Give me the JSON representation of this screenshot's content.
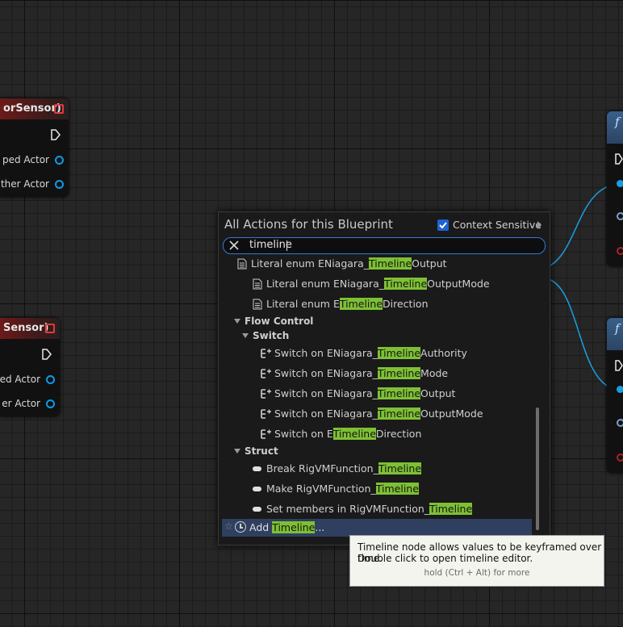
{
  "left_nodes": [
    {
      "title": "orSensor)",
      "pins": [
        "ped Actor",
        "ther Actor"
      ]
    },
    {
      "title": "Sensor)",
      "pins": [
        "ed Actor",
        "er Actor"
      ]
    }
  ],
  "right_nodes": [
    {
      "icon": "f"
    },
    {
      "icon": "f"
    }
  ],
  "menu": {
    "title": "All Actions for this Blueprint",
    "context_label": "Context Sensitive",
    "context_checked": true,
    "search_value": "timeline",
    "highlight_color": "#7ec034",
    "rows": [
      {
        "pre": "Literal enum ENiagara_",
        "hl": "Timeline",
        "post": "Output"
      },
      {
        "pre": "Literal enum ENiagara_",
        "hl": "Timeline",
        "post": "OutputMode"
      },
      {
        "pre": "Literal enum E",
        "hl": "Timeline",
        "post": "Direction"
      },
      {
        "category": "Flow Control"
      },
      {
        "category": "Switch"
      },
      {
        "pre": "Switch on ENiagara_",
        "hl": "Timeline",
        "post": "Authority"
      },
      {
        "pre": "Switch on ENiagara_",
        "hl": "Timeline",
        "post": "Mode"
      },
      {
        "pre": "Switch on ENiagara_",
        "hl": "Timeline",
        "post": "Output"
      },
      {
        "pre": "Switch on ENiagara_",
        "hl": "Timeline",
        "post": "OutputMode"
      },
      {
        "pre": "Switch on E",
        "hl": "Timeline",
        "post": "Direction"
      },
      {
        "category": "Struct"
      },
      {
        "pre": "Break RigVMFunction_",
        "hl": "Timeline",
        "post": ""
      },
      {
        "pre": "Make RigVMFunction_",
        "hl": "Timeline",
        "post": ""
      },
      {
        "pre": "Set members in RigVMFunction_",
        "hl": "Timeline",
        "post": ""
      }
    ],
    "add_item": {
      "pre": "Add ",
      "hl": "Timeline",
      "post": "..."
    }
  },
  "tooltip": {
    "line1": "Timeline node allows values to be keyframed over time.",
    "line2": "Double click to open timeline editor.",
    "hint": "hold (Ctrl + Alt) for more"
  },
  "colors": {
    "wire": "#1a9ee0",
    "accent": "#2f7bd6",
    "header_red": "#6c1a1a",
    "function_blue": "#3a5f8b"
  }
}
